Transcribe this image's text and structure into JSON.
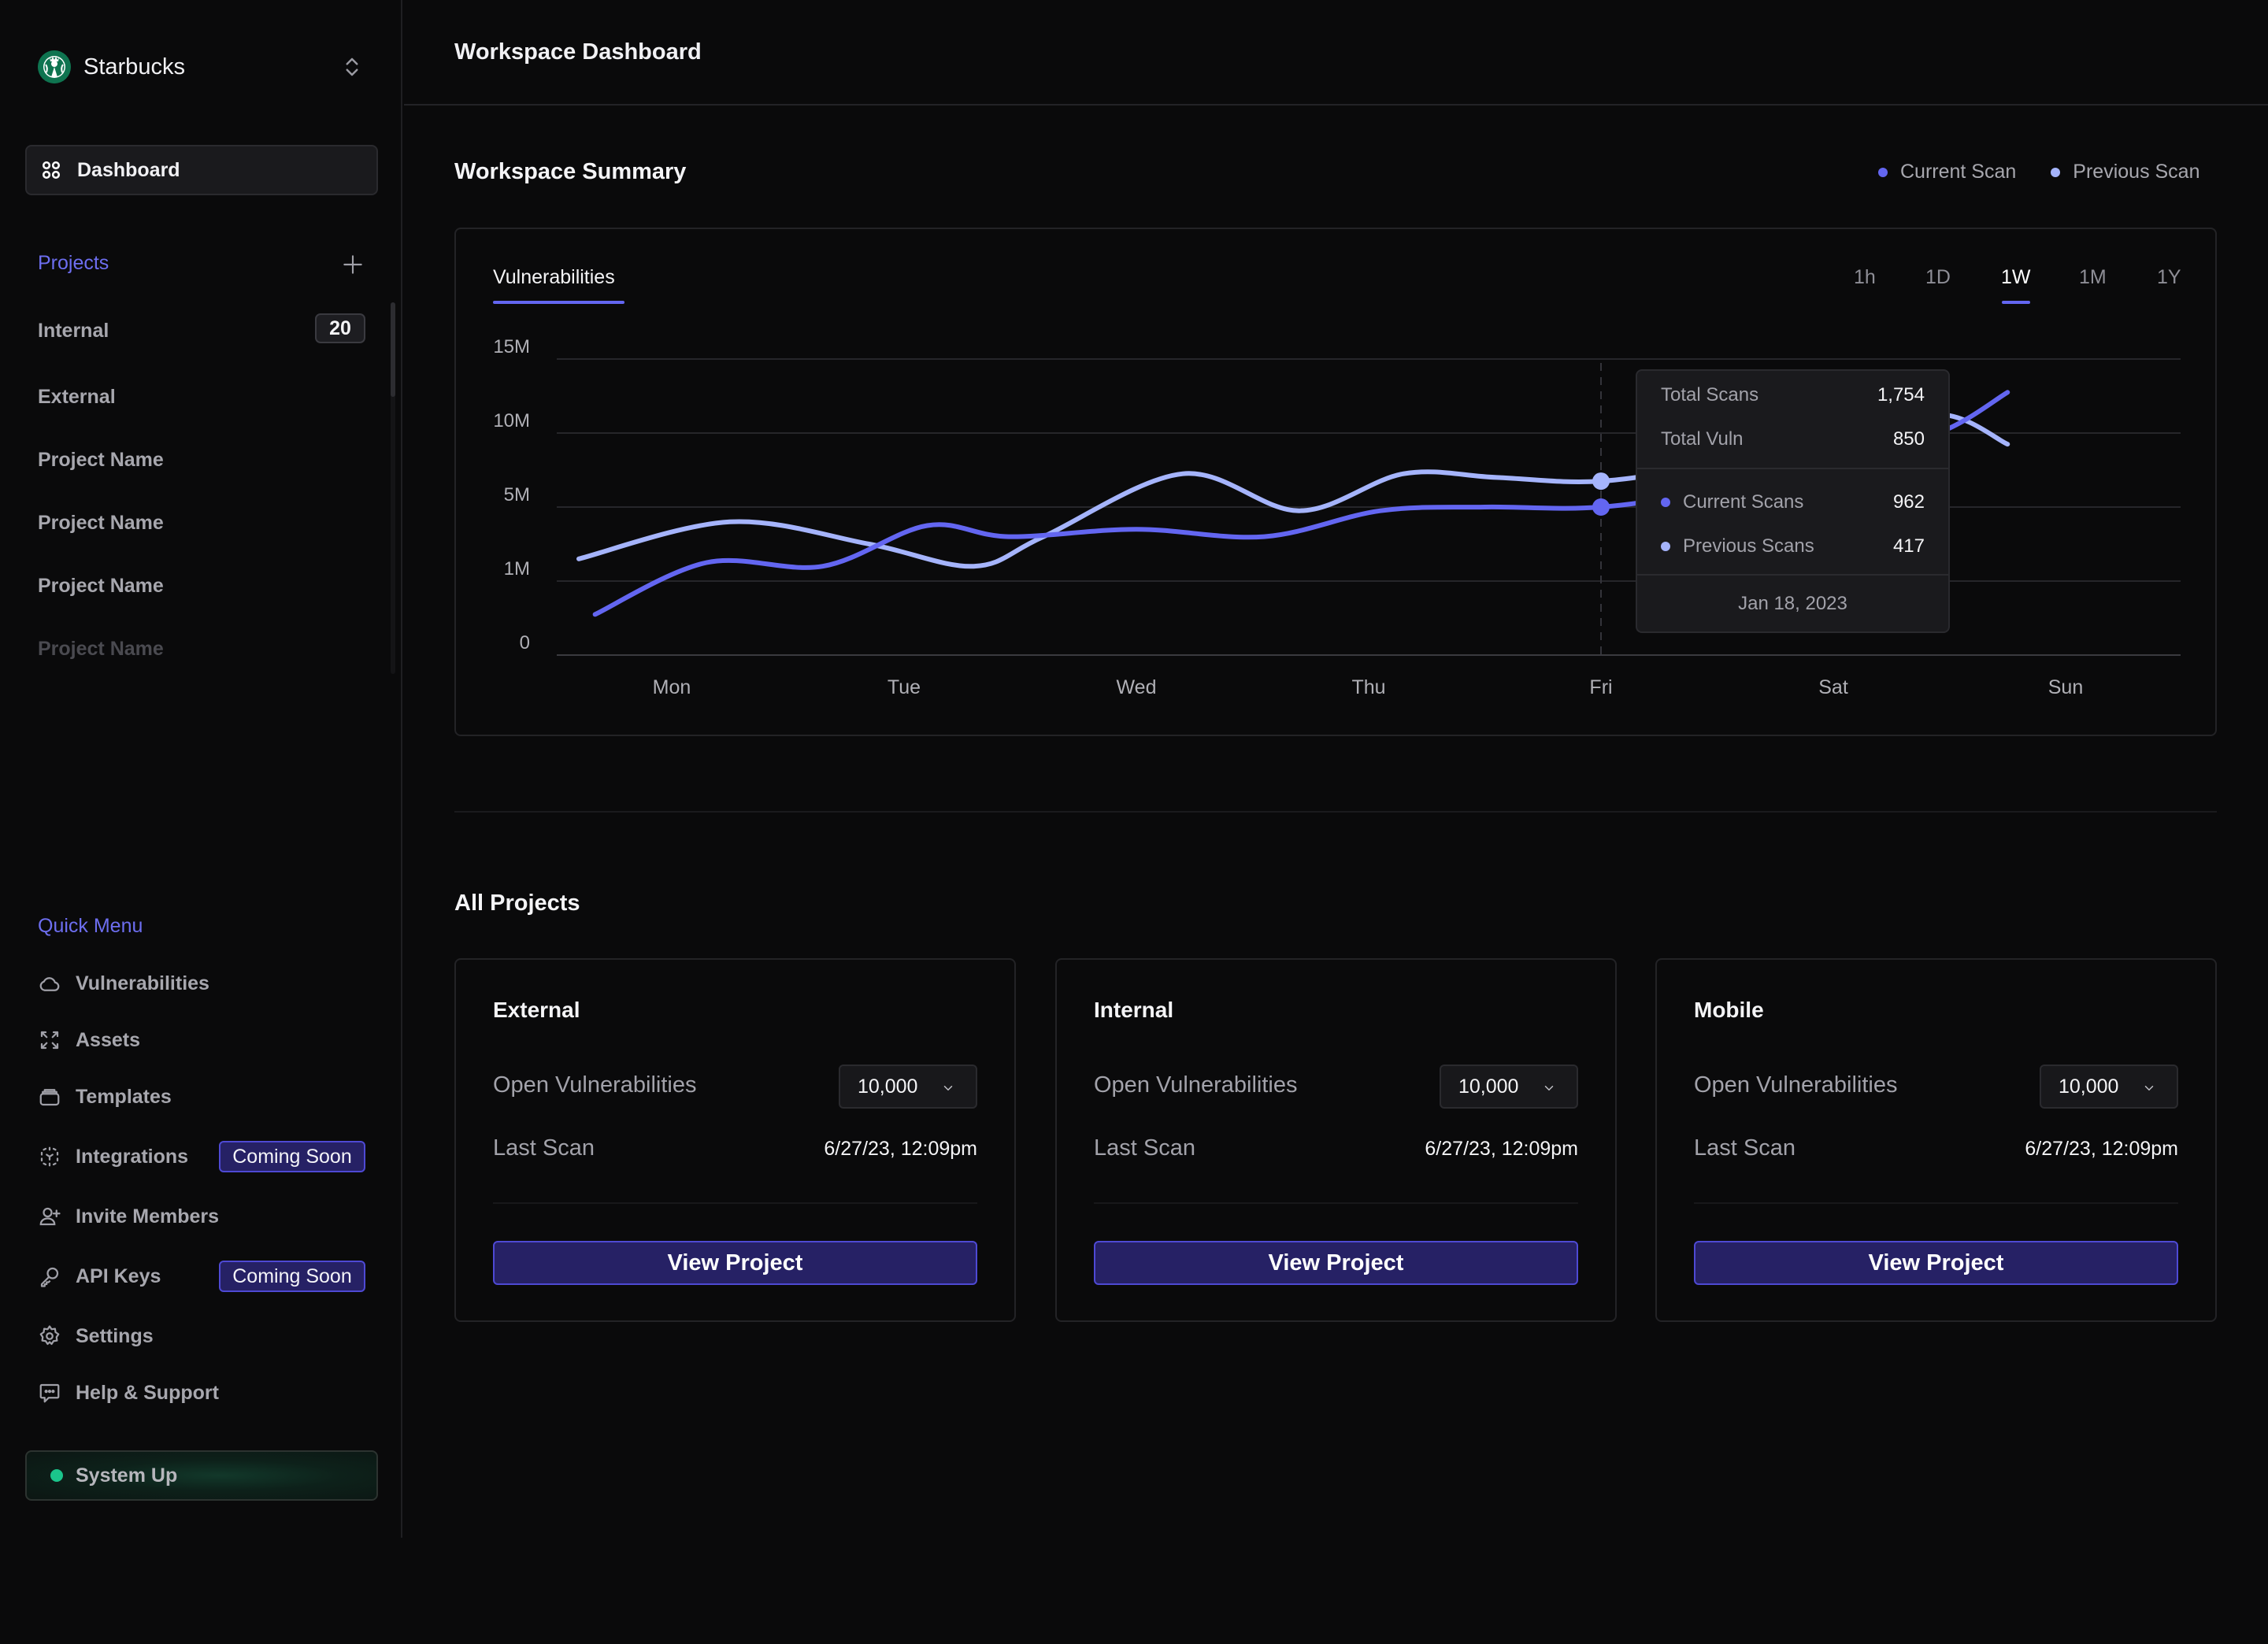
{
  "workspace": {
    "name": "Starbucks",
    "logo_icon": "starbucks-siren-logo"
  },
  "sidebar": {
    "dashboard_label": "Dashboard",
    "projects_heading": "Projects",
    "projects": [
      {
        "name": "Internal",
        "count": "20"
      },
      {
        "name": "External"
      },
      {
        "name": "Project Name"
      },
      {
        "name": "Project Name"
      },
      {
        "name": "Project Name"
      },
      {
        "name": "Project Name"
      }
    ],
    "quick_menu_heading": "Quick Menu",
    "quick_menu": [
      {
        "label": "Vulnerabilities",
        "icon": "cloud-icon"
      },
      {
        "label": "Assets",
        "icon": "expand-icon"
      },
      {
        "label": "Templates",
        "icon": "stack-icon"
      },
      {
        "label": "Integrations",
        "icon": "integrations-icon",
        "badge": "Coming Soon"
      },
      {
        "label": "Invite Members",
        "icon": "user-plus-icon"
      },
      {
        "label": "API Keys",
        "icon": "key-icon",
        "badge": "Coming Soon"
      },
      {
        "label": "Settings",
        "icon": "gear-icon"
      },
      {
        "label": "Help & Support",
        "icon": "chat-icon"
      }
    ],
    "status": {
      "label": "System Up",
      "color": "#1bc58b"
    }
  },
  "header": {
    "title": "Workspace Dashboard"
  },
  "summary": {
    "title": "Workspace Summary",
    "legend": [
      {
        "label": "Current Scan",
        "color": "#6366f1"
      },
      {
        "label": "Previous Scan",
        "color": "#a5b4fc"
      }
    ],
    "tab": "Vulnerabilities",
    "ranges": [
      "1h",
      "1D",
      "1W",
      "1M",
      "1Y"
    ],
    "active_range": "1W",
    "tooltip": {
      "total_scans_label": "Total Scans",
      "total_scans": "1,754",
      "total_vuln_label": "Total Vuln",
      "total_vuln": "850",
      "current_label": "Current Scans",
      "current_value": "962",
      "previous_label": "Previous Scans",
      "previous_value": "417",
      "date": "Jan 18, 2023"
    }
  },
  "chart_data": {
    "type": "line",
    "title": "Vulnerabilities",
    "xlabel": "",
    "ylabel": "",
    "categories": [
      "Mon",
      "Tue",
      "Wed",
      "Thu",
      "Fri",
      "Sat",
      "Sun"
    ],
    "y_ticks": [
      "0",
      "1M",
      "5M",
      "10M",
      "15M"
    ],
    "y_tick_positions_note": "ticks are evenly spaced categorical steps (0,1M,5M,10M,15M)",
    "ylim": [
      0,
      15000000
    ],
    "grid": true,
    "legend": "top-right",
    "highlight": {
      "category": "Fri",
      "date": "Jan 18, 2023"
    },
    "series": [
      {
        "name": "Current Scan",
        "color": "#6366f1",
        "x": [
          -0.33,
          0.15,
          0.65,
          1.1,
          1.45,
          2.0,
          2.55,
          3.05,
          3.5,
          4.0,
          4.5,
          5.0,
          5.45,
          5.75
        ],
        "values_scale_units": [
          0.55,
          1.25,
          1.2,
          1.75,
          1.6,
          1.7,
          1.6,
          1.95,
          2.0,
          2.0,
          2.25,
          2.7,
          3.0,
          3.55
        ]
      },
      {
        "name": "Previous Scan",
        "color": "#a5b4fc",
        "x": [
          -0.4,
          0.25,
          0.85,
          1.3,
          1.6,
          2.2,
          2.7,
          3.15,
          3.55,
          4.0,
          4.55,
          5.0,
          5.45,
          5.75
        ],
        "values_scale_units": [
          1.3,
          1.8,
          1.5,
          1.2,
          1.6,
          2.45,
          1.95,
          2.45,
          2.4,
          2.35,
          2.6,
          2.8,
          3.25,
          2.85
        ]
      }
    ]
  },
  "all_projects": {
    "title": "All Projects",
    "open_vuln_label": "Open Vulnerabilities",
    "last_scan_label": "Last Scan",
    "view_label": "View Project",
    "cards": [
      {
        "name": "External",
        "open_vulns": "10,000",
        "last_scan": "6/27/23,  12:09pm"
      },
      {
        "name": "Internal",
        "open_vulns": "10,000",
        "last_scan": "6/27/23,  12:09pm"
      },
      {
        "name": "Mobile",
        "open_vulns": "10,000",
        "last_scan": "6/27/23,  12:09pm"
      }
    ]
  }
}
